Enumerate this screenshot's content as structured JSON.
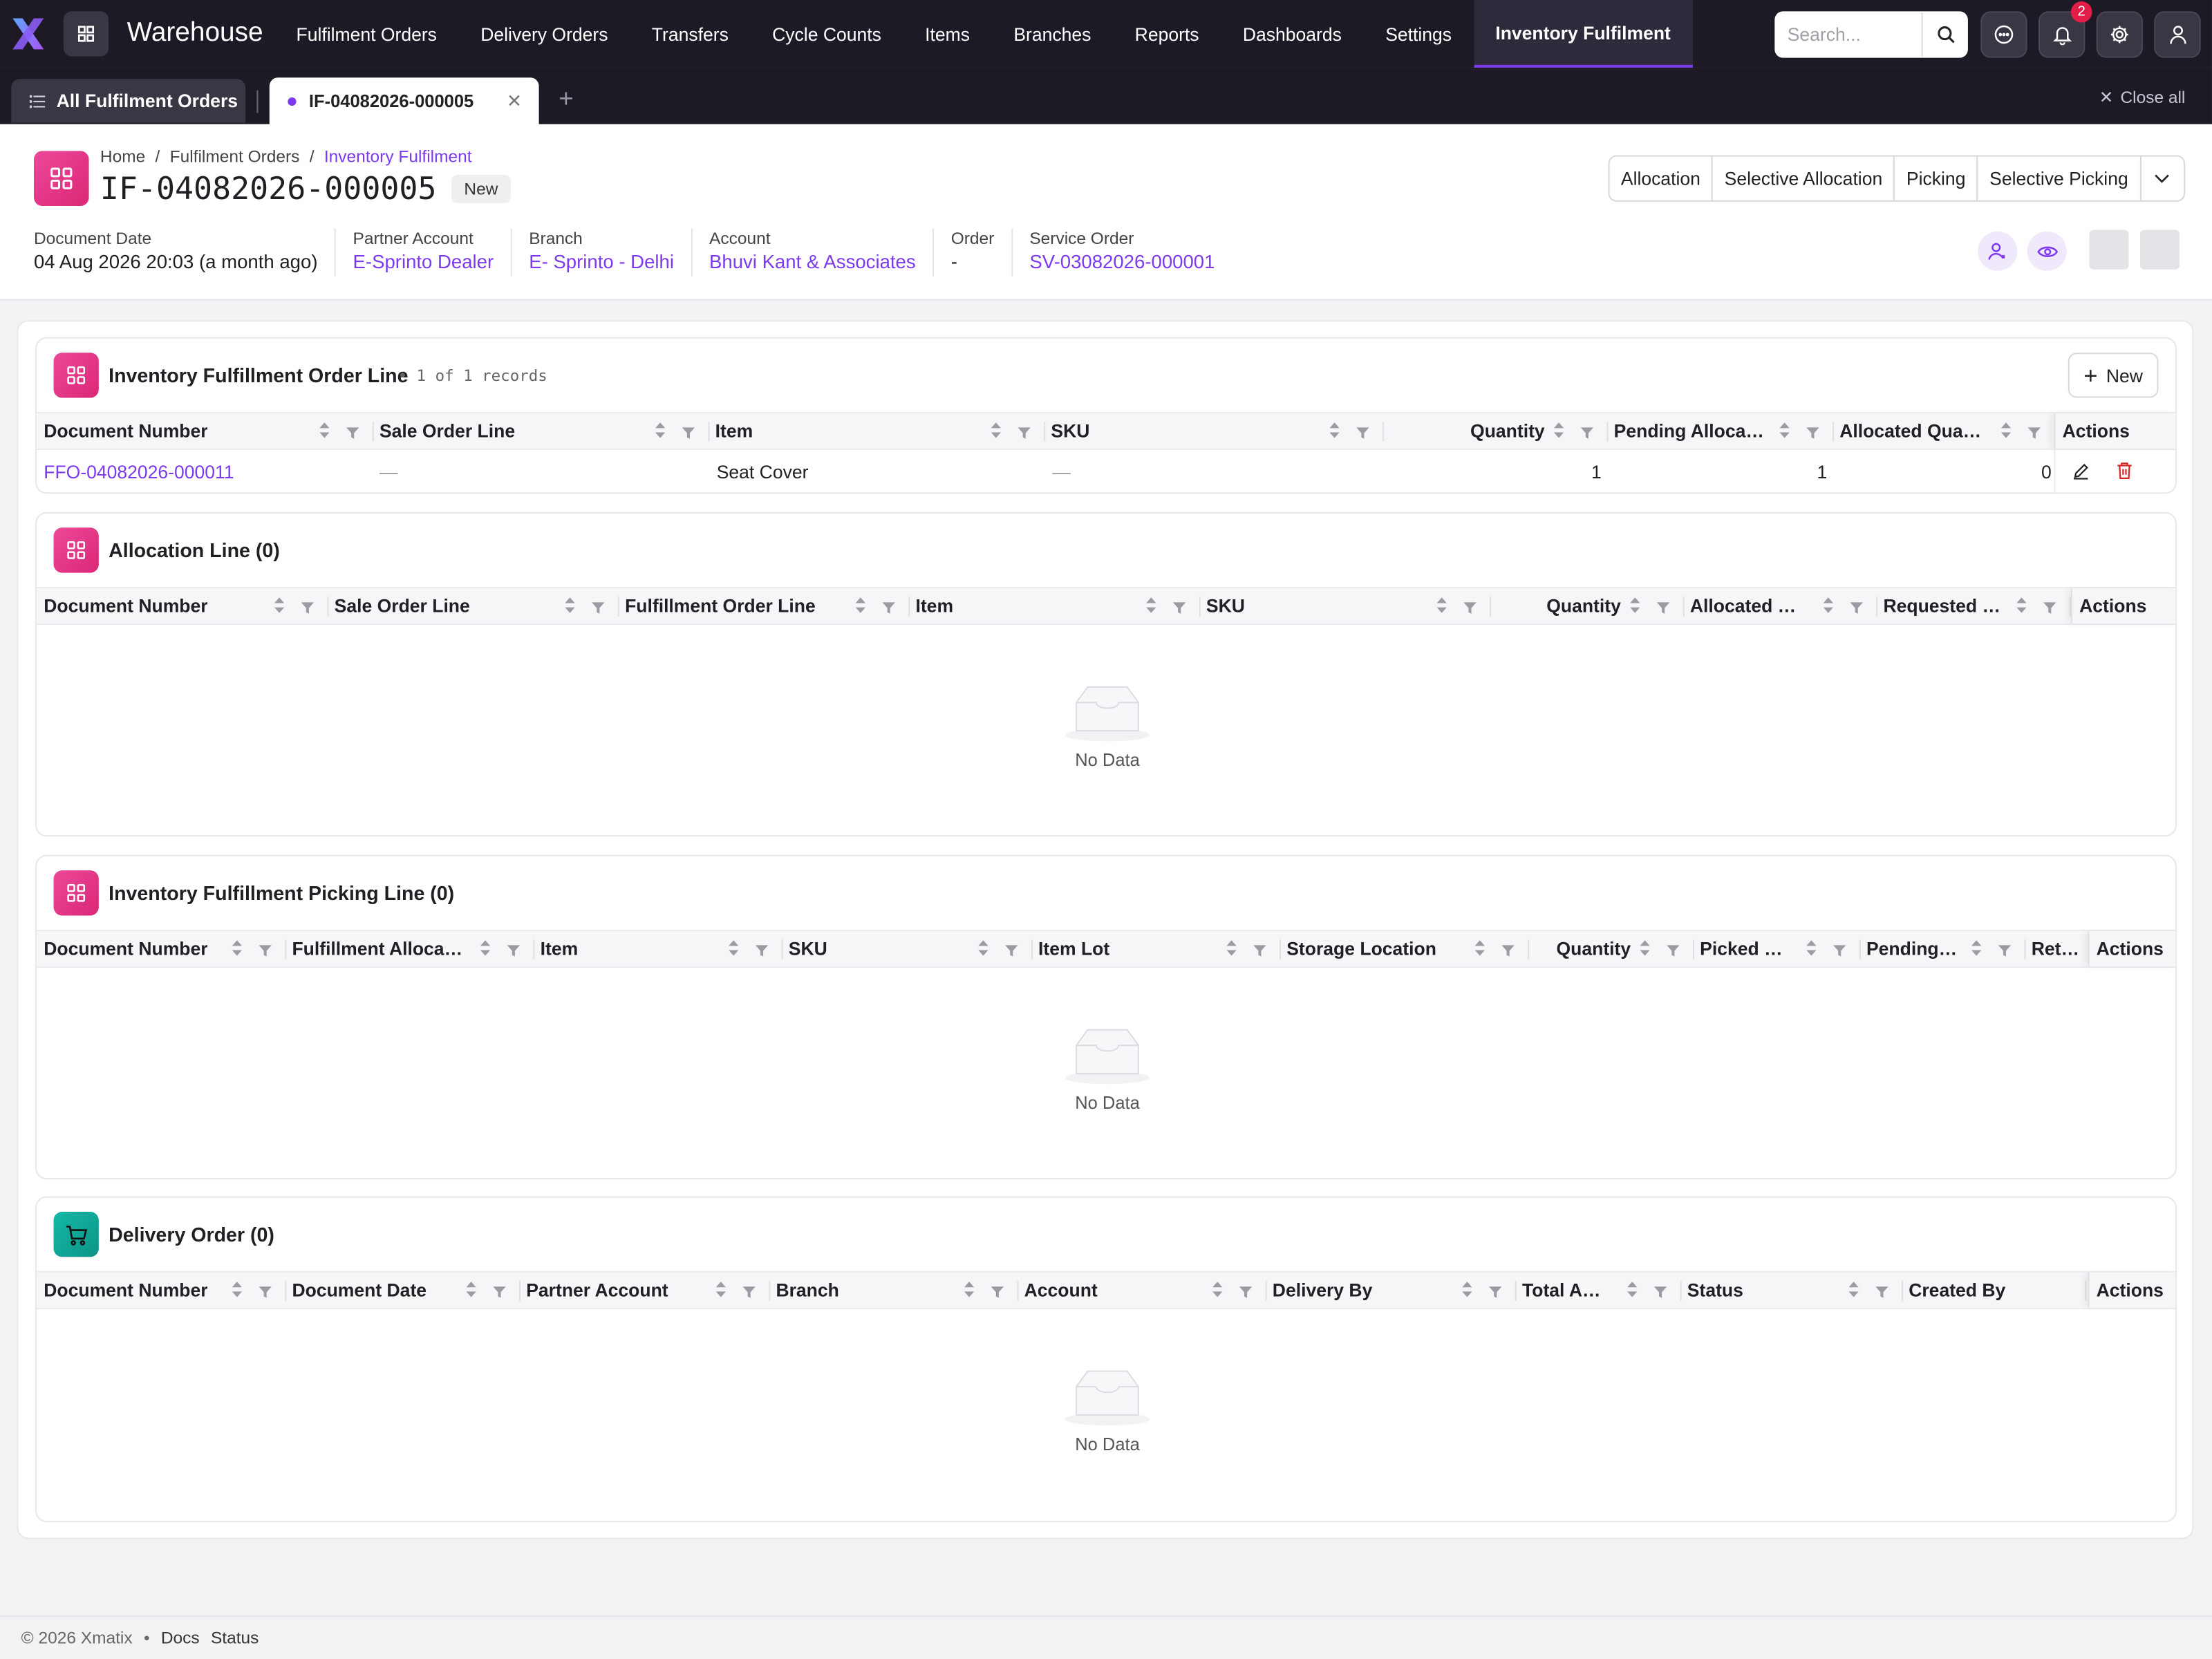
{
  "app": {
    "name": "Warehouse"
  },
  "nav": [
    "Fulfilment Orders",
    "Delivery Orders",
    "Transfers",
    "Cycle Counts",
    "Items",
    "Branches",
    "Reports",
    "Dashboards",
    "Settings",
    "Inventory Fulfilment"
  ],
  "search": {
    "placeholder": "Search..."
  },
  "notifications": {
    "count": "2"
  },
  "tabs": {
    "all": "All Fulfilment Orders",
    "open": "IF-04082026-000005",
    "close_all": "Close all"
  },
  "breadcrumb": {
    "home": "Home",
    "parent": "Fulfilment Orders",
    "current": "Inventory Fulfilment",
    "sep": "/"
  },
  "doc": {
    "number": "IF-04082026-000005",
    "status": "New"
  },
  "actions": [
    "Allocation",
    "Selective Allocation",
    "Picking",
    "Selective Picking"
  ],
  "meta": [
    {
      "label": "Document Date",
      "value": "04 Aug 2026 20:03 (a month ago)"
    },
    {
      "label": "Partner Account",
      "value": "E-Sprinto Dealer"
    },
    {
      "label": "Branch",
      "value": "E- Sprinto - Delhi"
    },
    {
      "label": "Account",
      "value": "Bhuvi Kant & Associates"
    },
    {
      "label": "Order",
      "value": "-"
    },
    {
      "label": "Service Order",
      "value": "SV-03082026-000001"
    }
  ],
  "order_lines": {
    "title": "Inventory Fulfillment Order Line",
    "records": "• 1 of 1 records",
    "new_label": "New",
    "columns": [
      "Document Number",
      "Sale Order Line",
      "Item",
      "SKU",
      "Quantity",
      "Pending Allocati...",
      "Allocated Quantity"
    ],
    "actions_label": "Actions",
    "rows": [
      {
        "document_number": "FFO-04082026-000011",
        "sale_order_line": "—",
        "item": "Seat Cover",
        "sku": "—",
        "quantity": "1",
        "pending": "1",
        "allocated": "0"
      }
    ]
  },
  "allocation_lines": {
    "title": "Allocation Line (0)",
    "columns": [
      "Document Number",
      "Sale Order Line",
      "Fulfillment Order Line",
      "Item",
      "SKU",
      "Quantity",
      "Allocated Qu...",
      "Requested Q..."
    ],
    "actions_label": "Actions",
    "empty": "No Data"
  },
  "picking_lines": {
    "title": "Inventory Fulfillment Picking Line (0)",
    "columns": [
      "Document Number",
      "Fulfillment Allocatio...",
      "Item",
      "SKU",
      "Item Lot",
      "Storage Location",
      "Quantity",
      "Picked Qu...",
      "Pending ...",
      "Return"
    ],
    "actions_label": "Actions",
    "empty": "No Data"
  },
  "delivery_orders": {
    "title": "Delivery Order (0)",
    "columns": [
      "Document Number",
      "Document Date",
      "Partner Account",
      "Branch",
      "Account",
      "Delivery By",
      "Total Amo...",
      "Status",
      "Created By"
    ],
    "actions_label": "Actions",
    "empty": "No Data"
  },
  "footer": {
    "copyright": "© 2026 Xmatix",
    "bullet": "•",
    "docs": "Docs",
    "status": "Status"
  },
  "colors": {
    "accent": "#7c3aed",
    "topbar": "#1d1a26",
    "pink": "#db2777",
    "teal": "#0d9488",
    "delete": "#dc2626"
  }
}
